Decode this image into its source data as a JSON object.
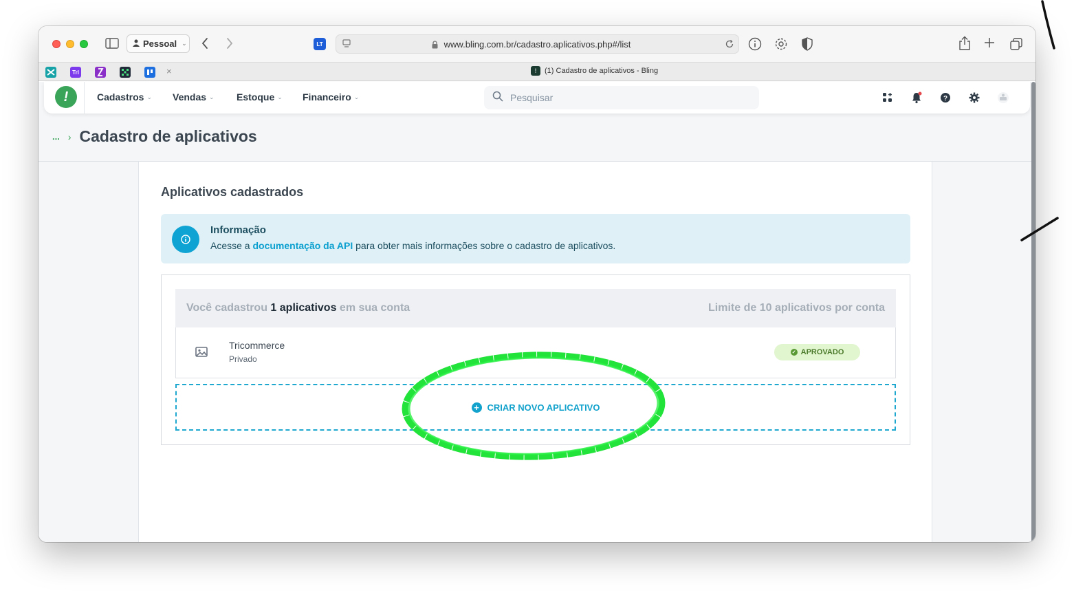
{
  "browser": {
    "profile_label": "Pessoal",
    "url": "www.bling.com.br/cadastro.aplicativos.php#/list",
    "extension_label": "LT",
    "pinned_tabs": [
      {
        "name": "pinned-tab-1",
        "color": "#17a2a8"
      },
      {
        "name": "pinned-tab-2",
        "color": "#7c3aed",
        "label": "Trl"
      },
      {
        "name": "pinned-tab-3",
        "color": "#8b2fc9"
      },
      {
        "name": "pinned-tab-4",
        "color": "#1f2937"
      },
      {
        "name": "pinned-tab-5",
        "color": "#1d6fe0"
      }
    ],
    "active_tab_title": "(1) Cadastro de aplicativos - Bling"
  },
  "nav": {
    "items": [
      "Cadastros",
      "Vendas",
      "Estoque",
      "Financeiro"
    ],
    "search_placeholder": "Pesquisar"
  },
  "breadcrumb": {
    "ellipsis": "...",
    "separator": "›",
    "title": "Cadastro de aplicativos"
  },
  "main": {
    "section_title": "Aplicativos cadastrados",
    "info": {
      "title": "Informação",
      "text_before": "Acesse a ",
      "link": "documentação da API",
      "text_after": " para obter mais informações sobre o cadastro de aplicativos."
    },
    "apps_header": {
      "prefix": "Você cadastrou ",
      "count": "1 aplicativos",
      "suffix": " em sua conta",
      "limit": "Limite de 10 aplicativos por conta"
    },
    "apps": [
      {
        "name": "Tricommerce",
        "visibility": "Privado",
        "status": "APROVADO"
      }
    ],
    "new_app_label": "CRIAR NOVO APLICATIVO"
  },
  "colors": {
    "accent": "#12a2cc",
    "brand_green": "#3aa458",
    "annotation_green": "#22e33a"
  }
}
